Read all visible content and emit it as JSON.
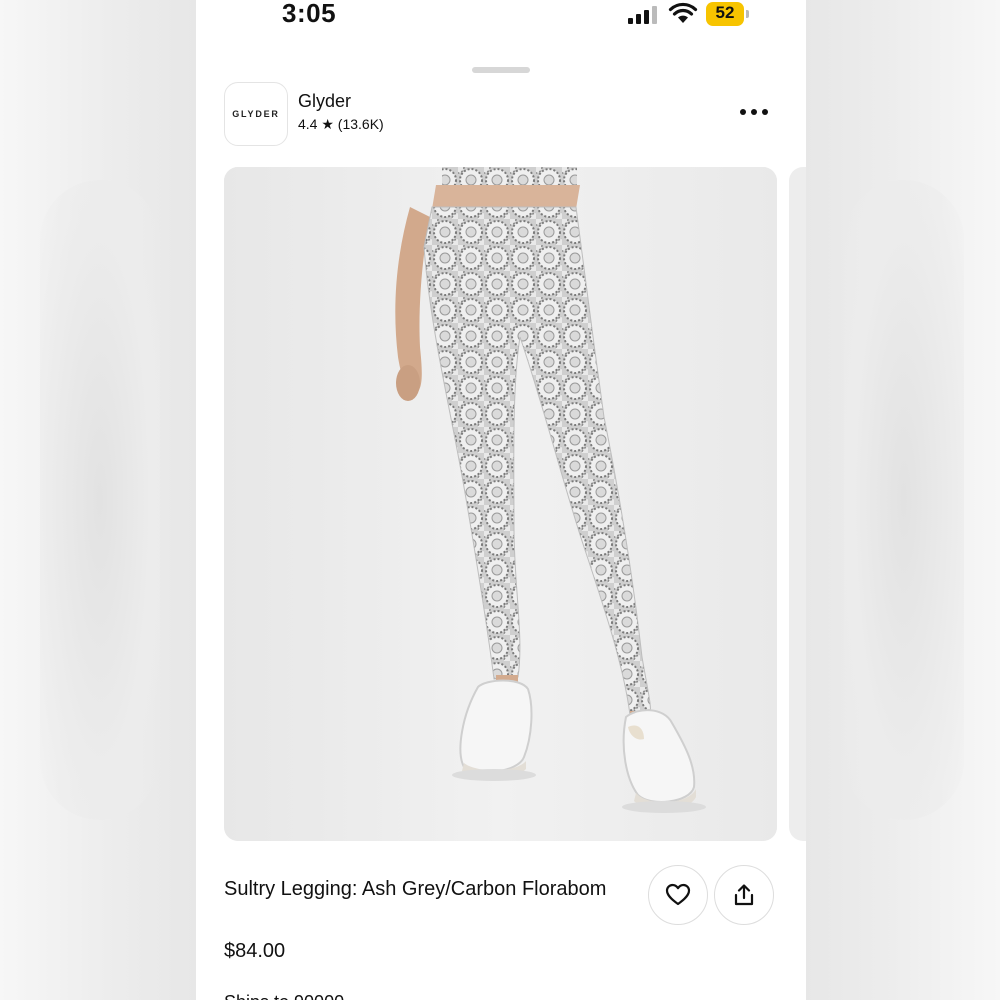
{
  "status_bar": {
    "time": "3:05",
    "battery_level": "52",
    "battery_color": "#f7c400"
  },
  "shop": {
    "logo_text": "GLYDER",
    "name": "Glyder",
    "rating": "4.4 ★ (13.6K)",
    "more_icon": "ellipsis-icon"
  },
  "product": {
    "image_description_icon": "product-photo",
    "title": "Sultry Legging: Ash Grey/Carbon Florabom",
    "price": "$84.00",
    "partially_visible_text": "Ships to 90000",
    "favorite_icon": "heart-icon",
    "share_icon": "share-icon"
  }
}
